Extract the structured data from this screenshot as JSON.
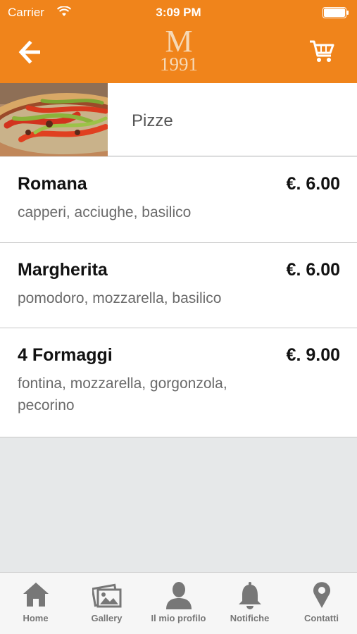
{
  "status_bar": {
    "carrier": "Carrier",
    "time": "3:09 PM"
  },
  "nav": {
    "logo_letter": "M",
    "logo_year": "1991",
    "back_icon": "arrow-left-icon",
    "cart_icon": "cart-icon"
  },
  "category": {
    "title": "Pizze"
  },
  "menu_items": [
    {
      "name": "Romana",
      "price": "€. 6.00",
      "description": "capperi, acciughe, basilico"
    },
    {
      "name": "Margherita",
      "price": "€. 6.00",
      "description": "pomodoro, mozzarella, basilico"
    },
    {
      "name": "4 Formaggi",
      "price": "€. 9.00",
      "description": "fontina, mozzarella, gorgonzola, pecorino"
    }
  ],
  "tabs": [
    {
      "label": "Home",
      "icon": "home-icon"
    },
    {
      "label": "Gallery",
      "icon": "gallery-icon"
    },
    {
      "label": "Il mio profilo",
      "icon": "profile-icon"
    },
    {
      "label": "Notifiche",
      "icon": "bell-icon"
    },
    {
      "label": "Contatti",
      "icon": "location-pin-icon"
    }
  ],
  "colors": {
    "accent": "#f0841b",
    "background": "#e6e8e9",
    "tab_icon": "#777777"
  }
}
